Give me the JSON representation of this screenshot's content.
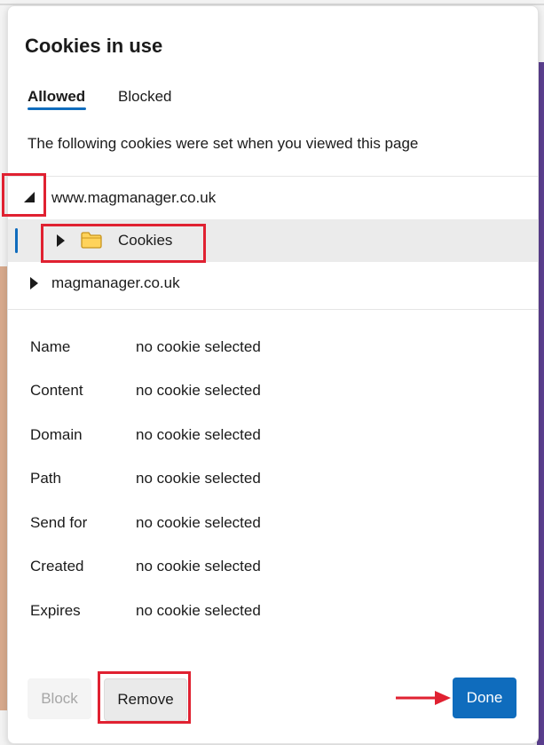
{
  "dialog": {
    "title": "Cookies in use",
    "tabs": [
      {
        "label": "Allowed",
        "active": true
      },
      {
        "label": "Blocked",
        "active": false
      }
    ],
    "description": "The following cookies were set when you viewed this page"
  },
  "tree": {
    "site": {
      "label": "www.magmanager.co.uk",
      "expanded": true
    },
    "site_child": {
      "label": "Cookies",
      "icon": "folder-icon",
      "selected": true
    },
    "domain": {
      "label": "magmanager.co.uk",
      "expanded": false
    }
  },
  "details": [
    {
      "label": "Name",
      "value": "no cookie selected"
    },
    {
      "label": "Content",
      "value": "no cookie selected"
    },
    {
      "label": "Domain",
      "value": "no cookie selected"
    },
    {
      "label": "Path",
      "value": "no cookie selected"
    },
    {
      "label": "Send for",
      "value": "no cookie selected"
    },
    {
      "label": "Created",
      "value": "no cookie selected"
    },
    {
      "label": "Expires",
      "value": "no cookie selected"
    }
  ],
  "buttons": {
    "block": {
      "label": "Block",
      "disabled": true
    },
    "remove": {
      "label": "Remove"
    },
    "done": {
      "label": "Done"
    }
  },
  "colors": {
    "accent": "#0f6cbd",
    "annotation": "#e02131",
    "folder": "#ffd35b"
  }
}
